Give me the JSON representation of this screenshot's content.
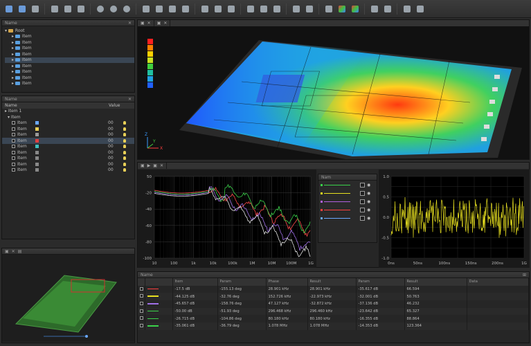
{
  "toolbar": {
    "icons": [
      "save-icon",
      "save-as-icon",
      "swap-icon",
      "undo-icon",
      "rotate-icon",
      "clear-icon",
      "zoom-in-icon",
      "zoom-out-icon",
      "zoom-fit-icon",
      "box-icon",
      "cube-icon",
      "select-icon",
      "fit-view-icon",
      "rotate-view-icon",
      "refresh-icon",
      "view-icon",
      "layout-icon",
      "layout-split-icon",
      "panel-icon",
      "settings-icon",
      "chip-icon",
      "timeline-icon",
      "chart-color-icon",
      "chart-icon",
      "gear-icon",
      "gear-advanced-icon",
      "grid-icon",
      "grid-large-icon"
    ]
  },
  "tree": {
    "title": "Name",
    "root": "Root",
    "items": [
      "Item",
      "Item",
      "Item",
      "Item",
      "Item",
      "Item",
      "Item",
      "Item",
      "Item"
    ]
  },
  "props": {
    "title": "Name",
    "columns": [
      "Name",
      "Value"
    ],
    "group": "Item 1",
    "subgroup": "Item",
    "rows": [
      {
        "name": "Item",
        "value": "00"
      },
      {
        "name": "Item",
        "value": "00"
      },
      {
        "name": "Item",
        "value": "00"
      },
      {
        "name": "Item",
        "value": "00"
      },
      {
        "name": "Item",
        "value": "00"
      },
      {
        "name": "Item",
        "value": "00"
      },
      {
        "name": "Item",
        "value": "00"
      },
      {
        "name": "Item",
        "value": "00"
      },
      {
        "name": "Item",
        "value": "00"
      }
    ]
  },
  "bode": {
    "ylabels": [
      "50",
      "-20",
      "-40",
      "-60",
      "-80",
      "-100"
    ],
    "xlabels": [
      "10",
      "100",
      "1k",
      "10k",
      "100k",
      "1M",
      "10M",
      "100M",
      "1G"
    ],
    "colors": [
      "#ff4a4a",
      "#3ad24a",
      "#a070e8",
      "#e0e0e0"
    ]
  },
  "legend": {
    "title": "Nam",
    "rows": [
      {
        "color": "#3ad24a"
      },
      {
        "color": "#e8e020"
      },
      {
        "color": "#b060e0"
      },
      {
        "color": "#ff4040"
      },
      {
        "color": "#6aa8ff"
      }
    ]
  },
  "scope": {
    "ylabels": [
      "1.0",
      "0.5",
      "0.0",
      "-0.5",
      "-1.0"
    ],
    "xlabels": [
      "0ns",
      "50ns",
      "100ns",
      "150ns",
      "200ns",
      "1G"
    ],
    "color": "#e8e020"
  },
  "table": {
    "title": "Name",
    "columns": [
      "",
      "",
      "Item ",
      "Param ",
      "Phase ",
      "Result ",
      "Param ",
      "Result ",
      "Data"
    ],
    "rows": [
      {
        "c1": "-17.5 dB",
        "c2": "-155.13 deg",
        "c3": "28.901 kHz",
        "c4": "28.901 kHz",
        "c5": "-35.617 dB",
        "c6": "66.594"
      },
      {
        "c1": "-44.125 dB",
        "c2": "-32.76 deg",
        "c3": "152.726 kHz",
        "c4": "-22.973 kHz",
        "c5": "-32.001 dB",
        "c6": "50.763"
      },
      {
        "c1": "-45.657 dB",
        "c2": "-158.76 deg",
        "c3": "47.127 kHz",
        "c4": "-32.872 kHz",
        "c5": "-37.136 dB",
        "c6": "46.232"
      },
      {
        "c1": "-50.00 dB",
        "c2": "-51.93 deg",
        "c3": "296.468 kHz",
        "c4": "296.460 kHz",
        "c5": "-23.642 dB",
        "c6": "65.327"
      },
      {
        "c1": "-26.715 dB",
        "c2": "-104.86 deg",
        "c3": "80.180 kHz",
        "c4": "80.180 kHz",
        "c5": "-16.355 dB",
        "c6": "88.864"
      },
      {
        "c1": "-35.061 dB",
        "c2": "-36.79 deg",
        "c3": "1.078 MHz",
        "c4": "1.078 MHz",
        "c5": "-14.353 dB",
        "c6": "123.364"
      }
    ]
  }
}
